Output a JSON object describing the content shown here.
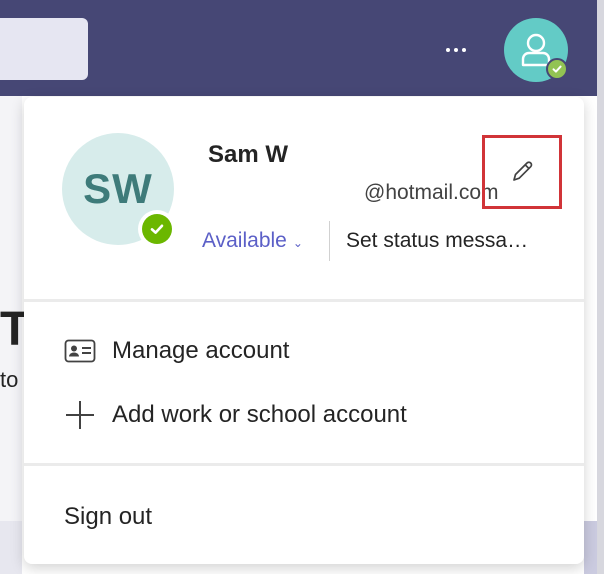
{
  "topbar": {
    "more_icon": "more-horizontal-icon",
    "avatar_icon": "person-icon",
    "presence": "available",
    "background_color": "#464775"
  },
  "background": {
    "partial_heading": "T",
    "partial_text": "to"
  },
  "profile": {
    "initials": "SW",
    "name": "Sam W",
    "email": "@hotmail.com",
    "presence_label": "Available",
    "status_message": "Set status messa…",
    "presence_color": "#6bb700",
    "accent_color": "#5b5fc7"
  },
  "menu": {
    "manage_account": "Manage account",
    "add_account": "Add work or school account",
    "sign_out": "Sign out"
  },
  "highlight_color": "#d13438"
}
